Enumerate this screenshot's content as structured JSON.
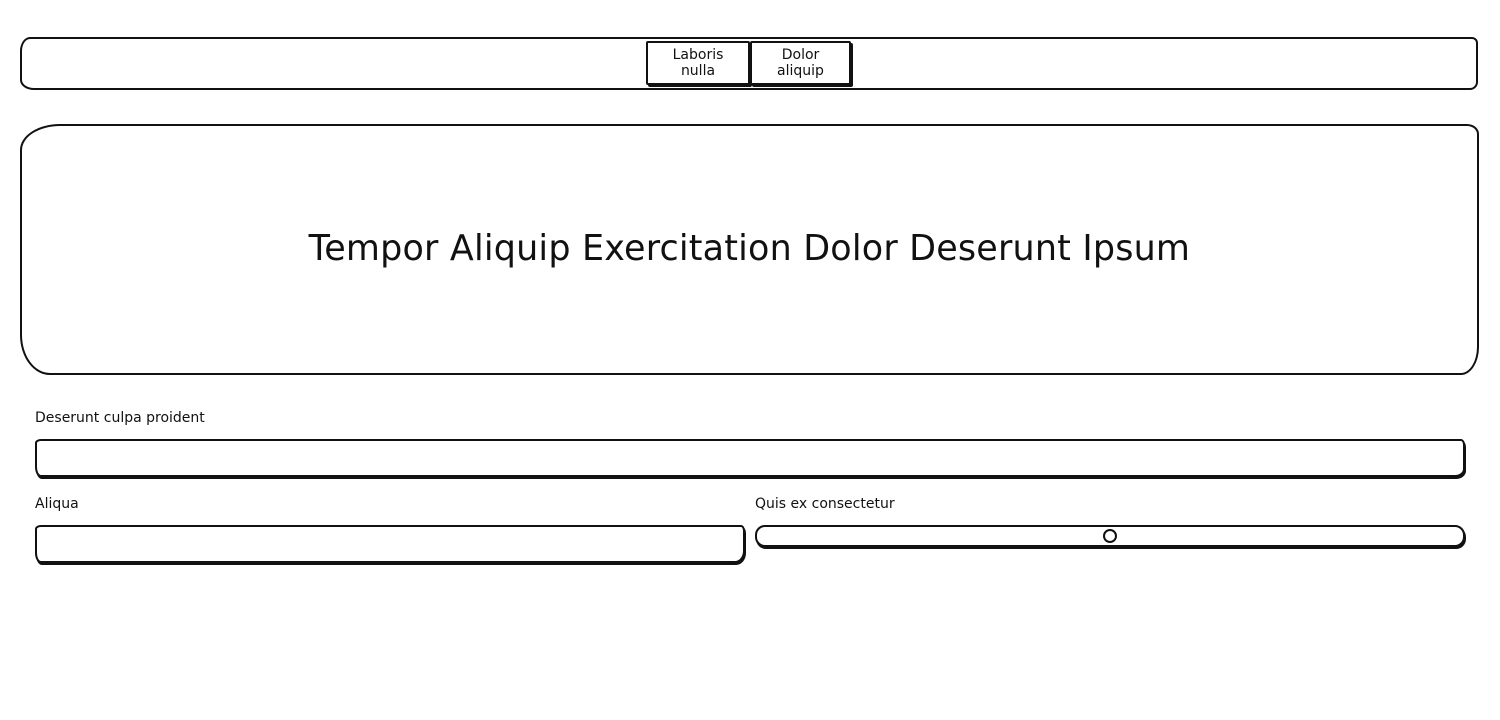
{
  "nav": {
    "buttons": [
      {
        "label": "Laboris nulla"
      },
      {
        "label": "Dolor aliquip"
      }
    ]
  },
  "hero": {
    "title": "Tempor Aliquip Exercitation Dolor Deserunt Ipsum"
  },
  "form": {
    "field1": {
      "label": "Deserunt culpa proident",
      "value": "",
      "placeholder": ""
    },
    "field2": {
      "label": "Aliqua",
      "value": "",
      "placeholder": ""
    },
    "slider": {
      "label": "Quis ex consectetur",
      "value": 0.5
    }
  }
}
